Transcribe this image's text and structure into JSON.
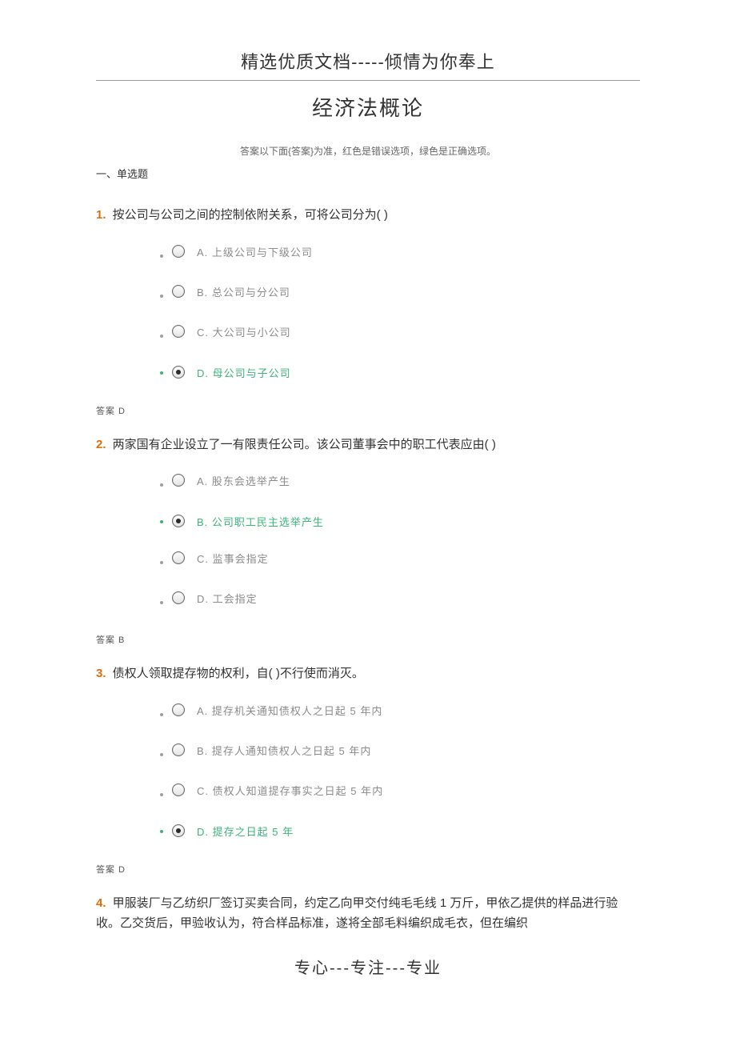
{
  "header": "精选优质文档-----倾情为你奉上",
  "title": "经济法概论",
  "instruction": "答案以下面{答案}为准，红色是错误选项，绿色是正确选项。",
  "section_heading": "一、单选题",
  "answer_prefix": "答案",
  "questions": [
    {
      "num": "1.",
      "stem": "按公司与公司之间的控制依附关系，可将公司分为(    )",
      "options": [
        {
          "letter": "A.",
          "text": "上级公司与下级公司",
          "correct": false,
          "selected": false
        },
        {
          "letter": "B.",
          "text": "总公司与分公司",
          "correct": false,
          "selected": false
        },
        {
          "letter": "C.",
          "text": "大公司与小公司",
          "correct": false,
          "selected": false
        },
        {
          "letter": "D.",
          "text": "母公司与子公司",
          "correct": true,
          "selected": true
        }
      ],
      "answer": "D"
    },
    {
      "num": "2.",
      "stem": "两家国有企业设立了一有限责任公司。该公司董事会中的职工代表应由(    )",
      "options": [
        {
          "letter": "A.",
          "text": "股东会选举产生",
          "correct": false,
          "selected": false
        },
        {
          "letter": "B.",
          "text": "公司职工民主选举产生",
          "correct": true,
          "selected": true
        },
        {
          "letter": "C.",
          "text": "监事会指定",
          "correct": false,
          "selected": false
        },
        {
          "letter": "D.",
          "text": "工会指定",
          "correct": false,
          "selected": false
        }
      ],
      "answer": "B"
    },
    {
      "num": "3.",
      "stem": "债权人领取提存物的权利，自(    )不行使而消灭。",
      "options": [
        {
          "letter": "A.",
          "text": "提存机关通知债权人之日起 5 年内",
          "correct": false,
          "selected": false
        },
        {
          "letter": "B.",
          "text": "提存人通知债权人之日起 5 年内",
          "correct": false,
          "selected": false
        },
        {
          "letter": "C.",
          "text": "债权人知道提存事实之日起 5 年内",
          "correct": false,
          "selected": false
        },
        {
          "letter": "D.",
          "text": "提存之日起 5 年",
          "correct": true,
          "selected": true
        }
      ],
      "answer": "D"
    },
    {
      "num": "4.",
      "stem": "甲服装厂与乙纺织厂签订买卖合同，约定乙向甲交付纯毛毛线 1 万斤，甲依乙提供的样品进行验收。乙交货后，甲验收认为，符合样品标准，遂将全部毛料编织成毛衣，但在编织",
      "options": [],
      "answer": null
    }
  ],
  "footer": "专心---专注---专业"
}
